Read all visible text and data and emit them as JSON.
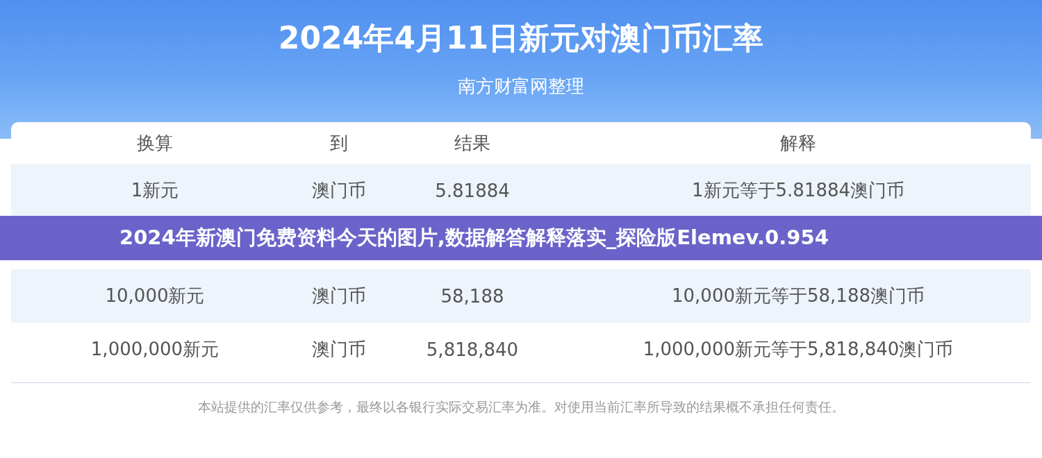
{
  "header": {
    "title": "2024年4月11日新元对澳门币汇率",
    "subtitle": "南方财富网整理"
  },
  "table": {
    "columns": [
      "换算",
      "到",
      "结果",
      "解释"
    ],
    "rows": [
      {
        "cells": [
          "1新元",
          "澳门币",
          "5.81884",
          "1新元等于5.81884澳门币"
        ]
      },
      {
        "cells": [
          "10,000新元",
          "澳门币",
          "58,188",
          "10,000新元等于58,188澳门币"
        ]
      },
      {
        "cells": [
          "1,000,000新元",
          "澳门币",
          "5,818,840",
          "1,000,000新元等于5,818,840澳门币"
        ]
      }
    ]
  },
  "footer": "本站提供的汇率仅供参考，最终以各银行实际交易汇率为准。对使用当前汇率所导致的结果概不承担任何责任。",
  "banner": "2024年新澳门免费资料今天的图片,数据解答解释落实_探险版Elemev.0.954"
}
